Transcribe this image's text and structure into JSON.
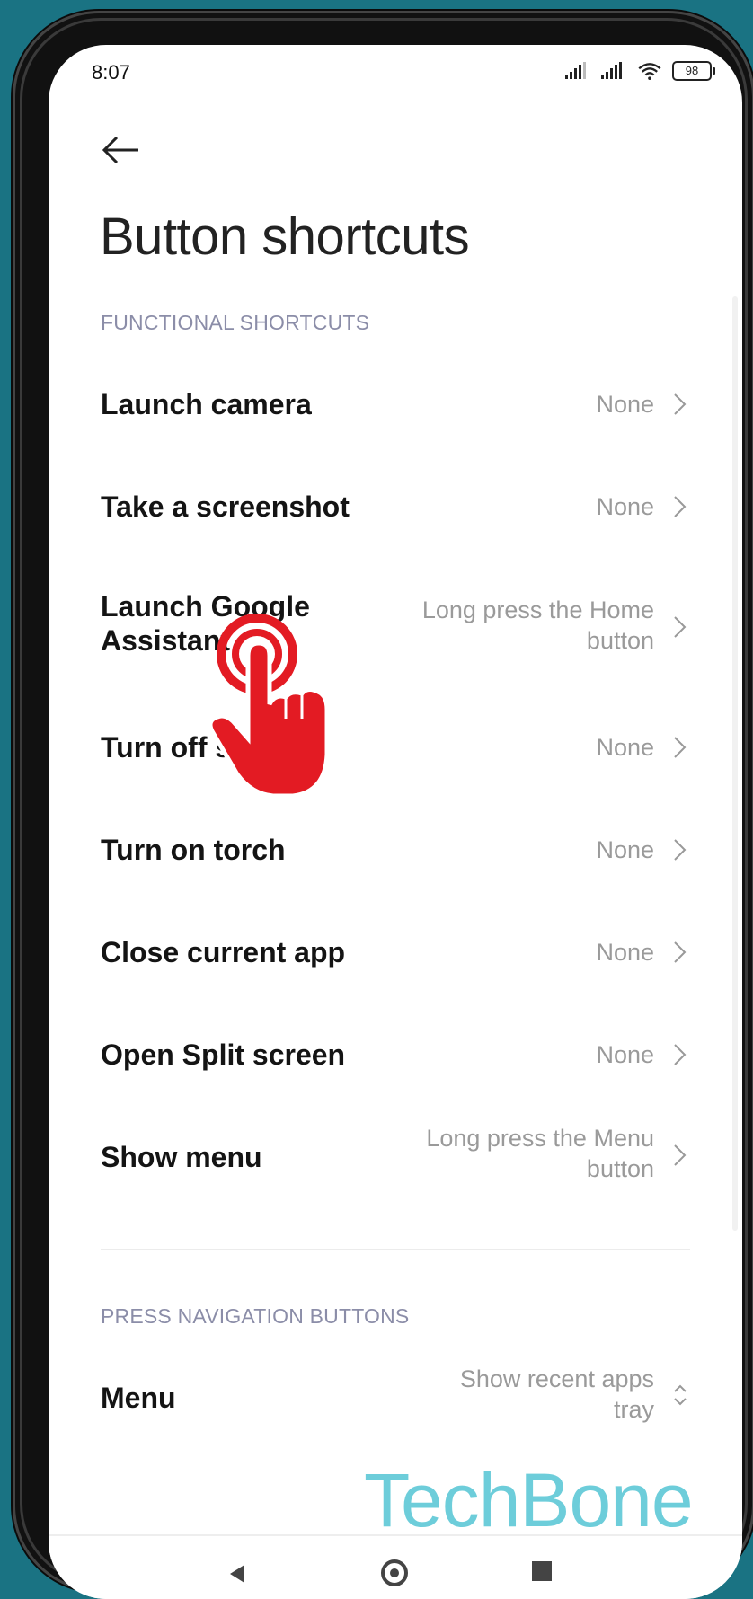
{
  "status": {
    "time": "8:07",
    "battery": "98"
  },
  "page": {
    "title": "Button shortcuts"
  },
  "sections": {
    "functional": "FUNCTIONAL SHORTCUTS",
    "navigation": "PRESS NAVIGATION BUTTONS"
  },
  "rows": [
    {
      "label": "Launch camera",
      "value": "None"
    },
    {
      "label": "Take a screenshot",
      "value": "None"
    },
    {
      "label_line1": "Launch Google",
      "label_line2": "Assistant",
      "value_line1": "Long press the Home",
      "value_line2": "button"
    },
    {
      "label": "Turn off screen",
      "value": "None"
    },
    {
      "label": "Turn on torch",
      "value": "None"
    },
    {
      "label": "Close current app",
      "value": "None"
    },
    {
      "label": "Open Split screen",
      "value": "None"
    },
    {
      "label": "Show menu",
      "value_line1": "Long press the Menu",
      "value_line2": "button"
    }
  ],
  "nav_rows": [
    {
      "label": "Menu",
      "value_line1": "Show recent apps",
      "value_line2": "tray"
    }
  ],
  "watermark": "TechBone",
  "colors": {
    "background": "#1a7383",
    "accent": "#e31b23",
    "section_label": "#8b8da8",
    "watermark": "#5ec8d6"
  }
}
